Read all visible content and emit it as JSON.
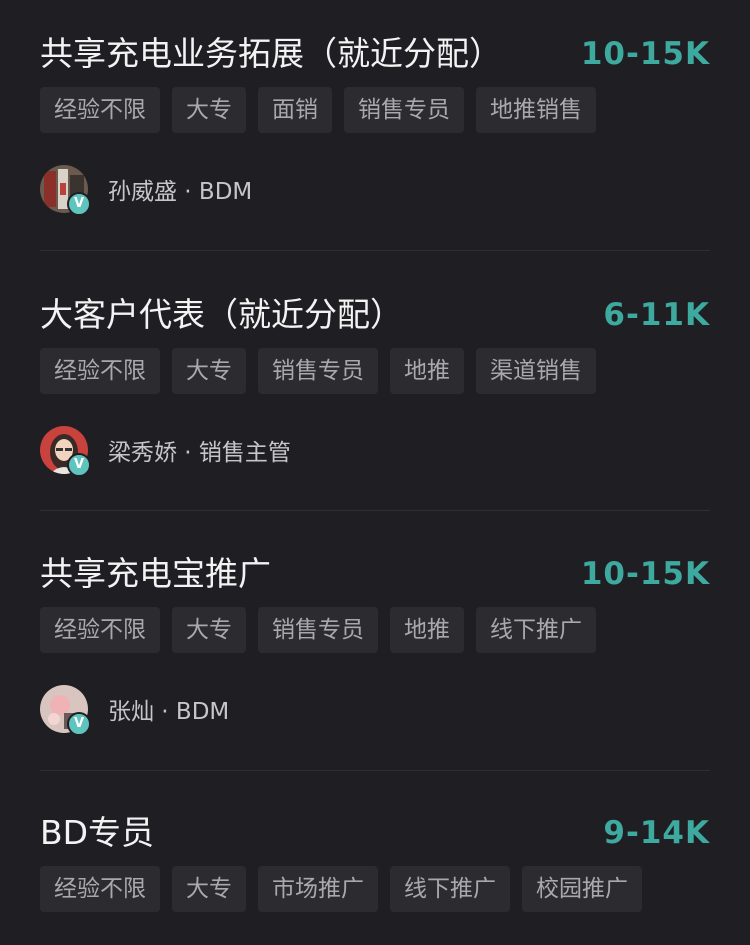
{
  "jobs": [
    {
      "title": "共享充电业务拓展（就近分配）",
      "salary": "10-15K",
      "tags": [
        "经验不限",
        "大专",
        "面销",
        "销售专员",
        "地推销售"
      ],
      "recruiter": "孙威盛 · BDM",
      "verified_icon": "V"
    },
    {
      "title": "大客户代表（就近分配）",
      "salary": "6-11K",
      "tags": [
        "经验不限",
        "大专",
        "销售专员",
        "地推",
        "渠道销售"
      ],
      "recruiter": "梁秀娇 · 销售主管",
      "verified_icon": "V"
    },
    {
      "title": "共享充电宝推广",
      "salary": "10-15K",
      "tags": [
        "经验不限",
        "大专",
        "销售专员",
        "地推",
        "线下推广"
      ],
      "recruiter": "张灿 · BDM",
      "verified_icon": "V"
    },
    {
      "title": "BD专员",
      "salary": "9-14K",
      "tags": [
        "经验不限",
        "大专",
        "市场推广",
        "线下推广",
        "校园推广"
      ]
    }
  ],
  "colors": {
    "background": "#1f1f23",
    "salary": "#3ea99f",
    "tag_bg": "#2c2c30",
    "verified_badge": "#5fc4bd"
  }
}
